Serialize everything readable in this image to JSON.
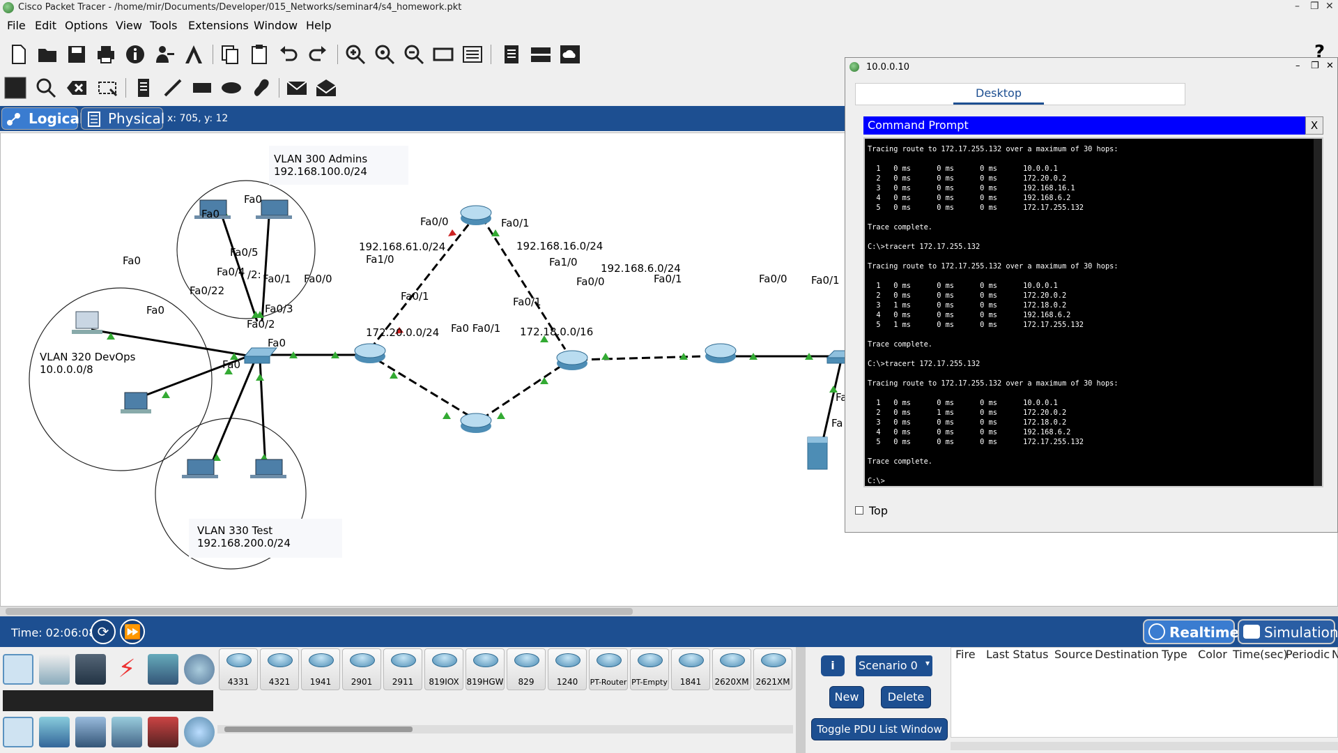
{
  "window": {
    "title": "Cisco Packet Tracer - /home/mir/Documents/Developer/015_Networks/seminar4/s4_homework.pkt"
  },
  "menu": [
    "File",
    "Edit",
    "Options",
    "View",
    "Tools",
    "Extensions",
    "Window",
    "Help"
  ],
  "mode": {
    "logical": "Logical",
    "physical": "Physical",
    "coords": "x: 705, y: 12"
  },
  "topology": {
    "labels": {
      "vlan300_name": "VLAN 300 Admins",
      "vlan300_net": "192.168.100.0/24",
      "vlan320_name": "VLAN 320 DevOps",
      "vlan320_net": "10.0.0.0/8",
      "vlan330_name": "VLAN 330 Test",
      "vlan330_net": "192.168.200.0/24",
      "net61": "192.168.61.0/24",
      "net16": "192.168.16.0/24",
      "net6": "192.168.6.0/24",
      "net20": "172.20.0.0/24",
      "net18": "172.18.0.0/16",
      "fa0": "Fa0",
      "fa0_5": "Fa0/5",
      "fa0_4": "Fa0/4",
      "fa0_22": "Fa0/22",
      "fa0_1": "Fa0/1",
      "fa0_0": "Fa0/0",
      "fa0_3": "Fa0/3",
      "fa0_2": "Fa0/2",
      "fa1_0": "Fa1/0",
      "fa0_slash": "/2:",
      "fa0_fa01": "Fa0 Fa0/1",
      "fa_partial": "Fa"
    }
  },
  "status": {
    "time": "Time: 02:06:08",
    "realtime": "Realtime",
    "simulation": "Simulation"
  },
  "devices": [
    "4331",
    "4321",
    "1941",
    "2901",
    "2911",
    "819IOX",
    "819HGW",
    "829",
    "1240",
    "PT-Router",
    "PT-Empty",
    "1841",
    "2620XM",
    "2621XM"
  ],
  "pdu": {
    "scenario": "Scenario 0",
    "new": "New",
    "delete": "Delete",
    "toggle": "Toggle PDU List Window",
    "columns": [
      "Fire",
      "Last Status",
      "Source",
      "Destination",
      "Type",
      "Color",
      "Time(sec)",
      "Periodic",
      "N"
    ]
  },
  "pc_window": {
    "title": "10.0.0.10",
    "tab": "Desktop",
    "cmd_title": "Command Prompt",
    "close": "X",
    "top_label": "Top",
    "terminal": "Tracing route to 172.17.255.132 over a maximum of 30 hops:\n\n  1   0 ms      0 ms      0 ms      10.0.0.1\n  2   0 ms      0 ms      0 ms      172.20.0.2\n  3   0 ms      0 ms      0 ms      192.168.16.1\n  4   0 ms      0 ms      0 ms      192.168.6.2\n  5   0 ms      0 ms      0 ms      172.17.255.132\n\nTrace complete.\n\nC:\\>tracert 172.17.255.132\n\nTracing route to 172.17.255.132 over a maximum of 30 hops:\n\n  1   0 ms      0 ms      0 ms      10.0.0.1\n  2   0 ms      0 ms      0 ms      172.20.0.2\n  3   1 ms      0 ms      0 ms      172.18.0.2\n  4   0 ms      0 ms      0 ms      192.168.6.2\n  5   1 ms      0 ms      0 ms      172.17.255.132\n\nTrace complete.\n\nC:\\>tracert 172.17.255.132\n\nTracing route to 172.17.255.132 over a maximum of 30 hops:\n\n  1   0 ms      0 ms      0 ms      10.0.0.1\n  2   0 ms      1 ms      0 ms      172.20.0.2\n  3   0 ms      0 ms      0 ms      172.18.0.2\n  4   0 ms      0 ms      0 ms      192.168.6.2\n  5   0 ms      0 ms      0 ms      172.17.255.132\n\nTrace complete.\n\nC:\\>"
  },
  "colors": {
    "accent": "#1d4f91",
    "cmd_title": "#0000ff",
    "link_up": "#33aa33",
    "link_down": "#cc2222"
  }
}
